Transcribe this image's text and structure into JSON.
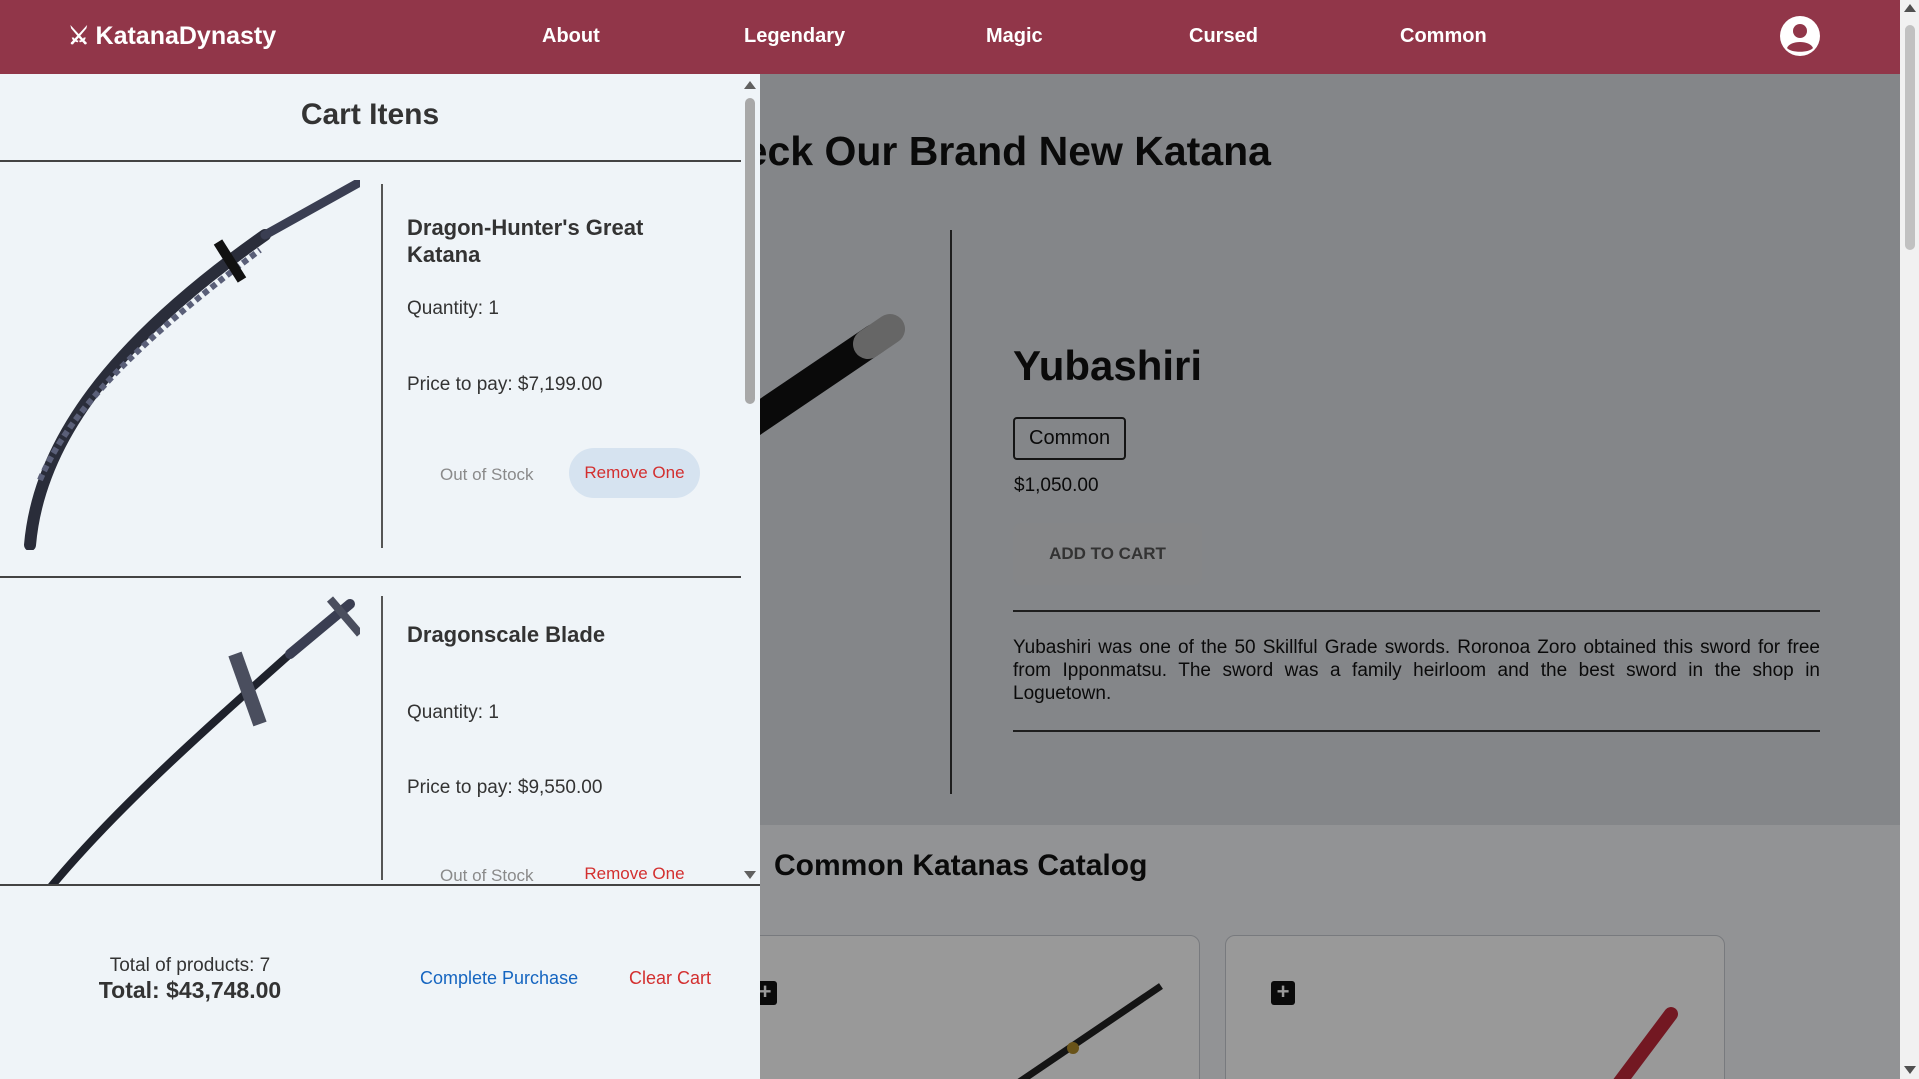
{
  "colors": {
    "navbar": "#913649",
    "cart_bg": "#eff4f8",
    "link_blue": "#1565c0",
    "danger_red": "#d32f2f"
  },
  "navbar": {
    "brand_icon": "crossed-swords-icon",
    "brand": "KatanaDynasty",
    "links": [
      "About",
      "Legendary",
      "Magic",
      "Cursed",
      "Common"
    ],
    "account_icon": "account-circle-icon"
  },
  "hero": {
    "title": "Check Our Brand New Katana",
    "product": {
      "name": "Yubashiri",
      "category": "Common",
      "price": "$1,050.00",
      "add_to_cart": "ADD TO CART",
      "description": "Yubashiri was one of the 50 Skillful Grade swords. Roronoa Zoro obtained this sword for free from Ipponmatsu. The sword was a family heirloom and the best sword in the shop in Loguetown."
    }
  },
  "catalog": {
    "title": "Common Katanas Catalog",
    "card_icon": "plus-square-icon"
  },
  "cart": {
    "title": "Cart Itens",
    "items": [
      {
        "name": "Dragon-Hunter's Great Katana",
        "quantity": "Quantity: 1",
        "price": "Price to pay: $7,199.00",
        "stock_status": "Out of Stock",
        "remove_label": "Remove One"
      },
      {
        "name": "Dragonscale Blade",
        "quantity": "Quantity: 1",
        "price": "Price to pay: $9,550.00",
        "stock_status": "Out of Stock",
        "remove_label": "Remove One"
      }
    ],
    "footer": {
      "total_products": "Total of products: 7",
      "total": "Total: $43,748.00",
      "complete_purchase": "Complete Purchase",
      "clear_cart": "Clear Cart"
    }
  }
}
